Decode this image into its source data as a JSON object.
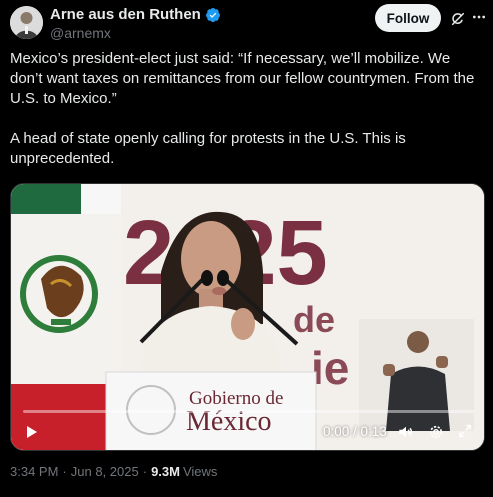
{
  "author": {
    "name": "Arne aus den Ruthen",
    "handle": "@arnemx",
    "verified": true,
    "verified_color": "#1d9bf0"
  },
  "actions": {
    "follow_label": "Follow",
    "grok_icon": "grok-icon",
    "more_icon": "more-icon"
  },
  "tweet": {
    "text": "Mexico’s president-elect just said: “If necessary, we’ll mobilize. We don’t want taxes on remittances from our fellow countrymen. From the U.S. to Mexico.”\n\nA head of state openly calling for protests in the U.S. This is unprecedented."
  },
  "video": {
    "time_display": "0:00 / 0:13",
    "progress": 0.0,
    "backdrop_numbers": "2025",
    "backdrop_words": [
      "de",
      "ie"
    ],
    "podium_line1": "Gobierno de",
    "podium_line2": "México"
  },
  "meta": {
    "time": "3:34 PM",
    "date": "Jun 8, 2025",
    "views_count": "9.3M",
    "views_label": "Views"
  }
}
